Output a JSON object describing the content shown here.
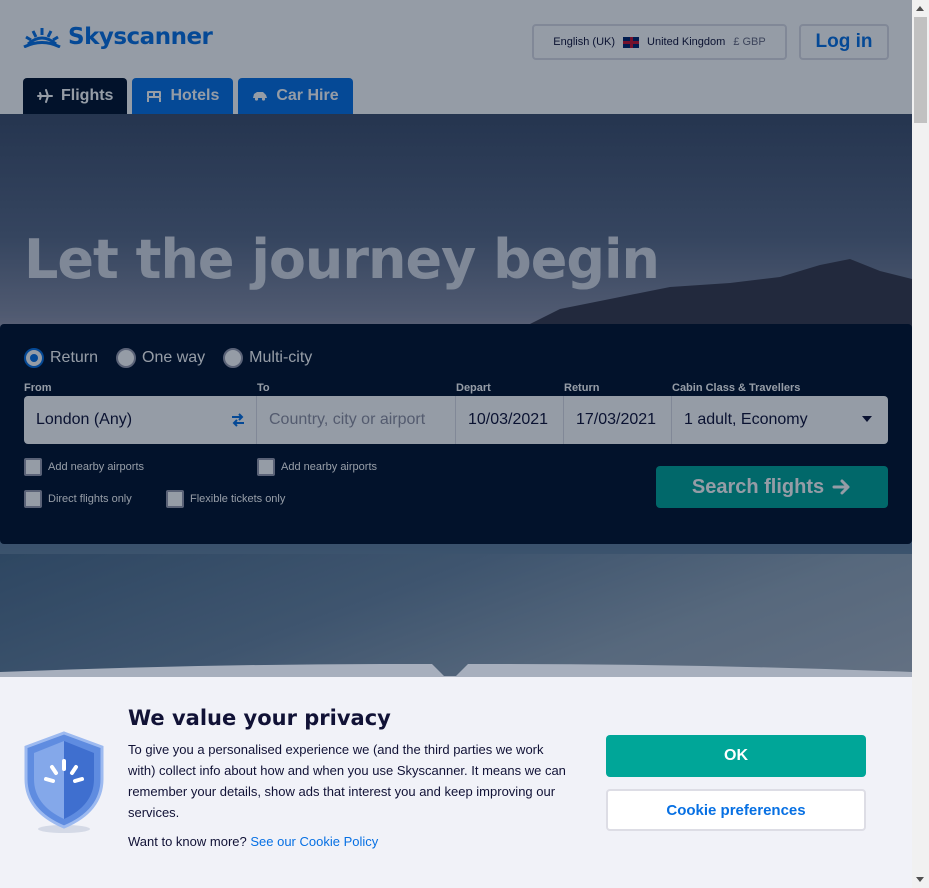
{
  "header": {
    "logo_text": "Skyscanner",
    "locale": {
      "language": "English (UK)",
      "country": "United Kingdom",
      "currency": "£ GBP"
    },
    "login_label": "Log in"
  },
  "tabs": [
    {
      "label": "Flights",
      "icon": "plane-icon",
      "active": true
    },
    {
      "label": "Hotels",
      "icon": "bed-icon",
      "active": false
    },
    {
      "label": "Car Hire",
      "icon": "car-icon",
      "active": false
    }
  ],
  "hero": {
    "title": "Let the journey begin"
  },
  "search": {
    "trip_types": [
      {
        "label": "Return",
        "checked": true
      },
      {
        "label": "One way",
        "checked": false
      },
      {
        "label": "Multi-city",
        "checked": false
      }
    ],
    "labels": {
      "from": "From",
      "to": "To",
      "depart": "Depart",
      "return": "Return",
      "cabin": "Cabin Class & Travellers"
    },
    "from_value": "London (Any)",
    "to_placeholder": "Country, city or airport",
    "depart_value": "10/03/2021",
    "return_value": "17/03/2021",
    "cabin_value": "1 adult, Economy",
    "options": {
      "nearby_from": "Add nearby airports",
      "nearby_to": "Add nearby airports",
      "direct": "Direct flights only",
      "flexible": "Flexible tickets only"
    },
    "submit_label": "Search flights"
  },
  "privacy": {
    "title": "We value your privacy",
    "body": "To give you a personalised experience we (and the third parties we work with) collect info about how and when you use Skyscanner. It means we can remember your details, show ads that interest you and keep improving our services.",
    "more_prefix": "Want to know more?",
    "more_link": "See our Cookie Policy",
    "ok_label": "OK",
    "prefs_label": "Cookie preferences"
  },
  "colors": {
    "brand_blue": "#0770e3",
    "navy": "#02122c",
    "teal": "#00a698"
  }
}
